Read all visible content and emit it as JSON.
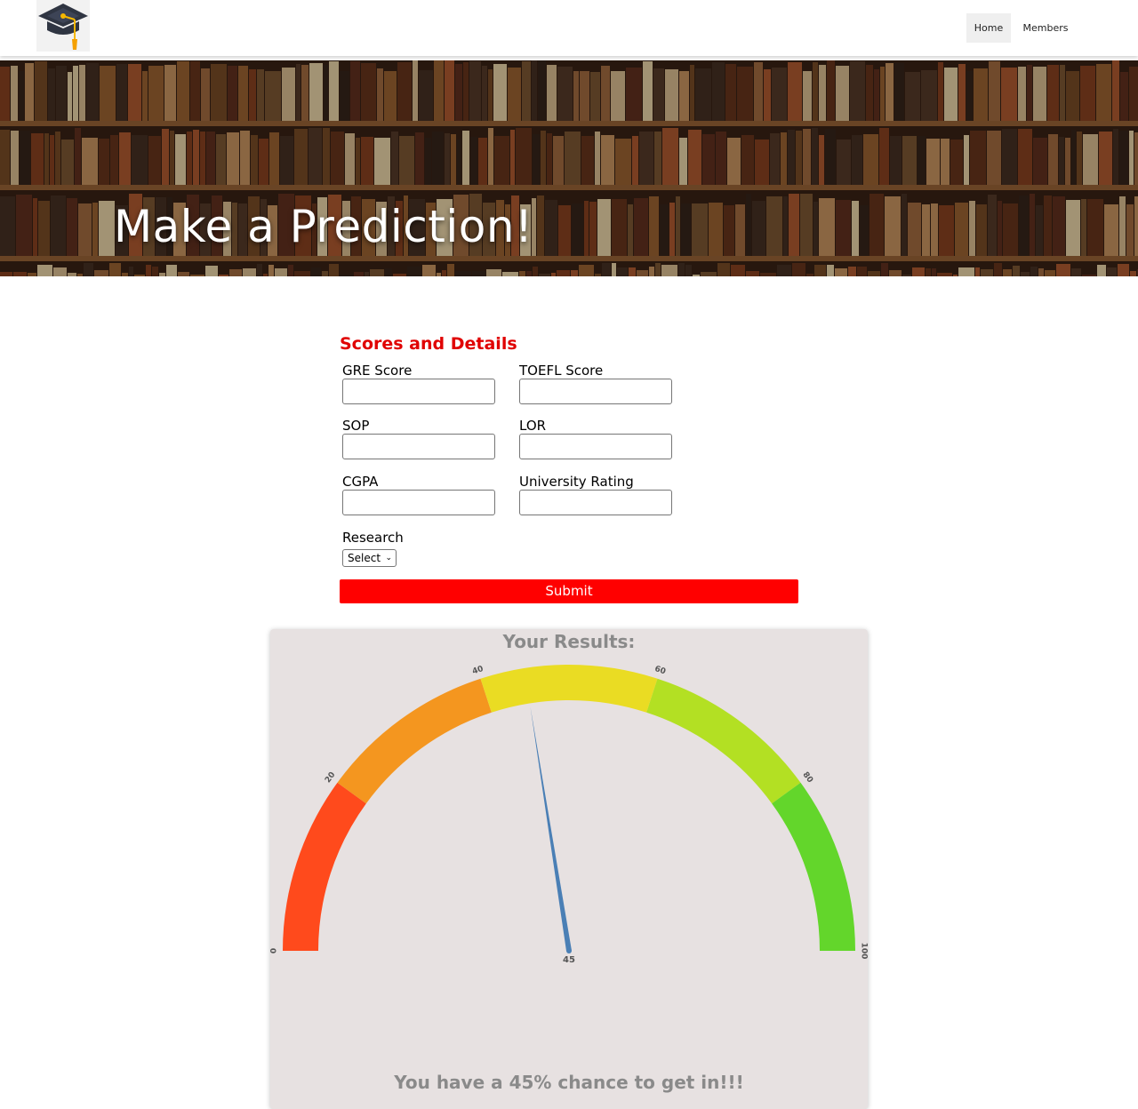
{
  "nav": {
    "logo_icon": "graduation-cap-icon",
    "items": [
      {
        "label": "Home",
        "active": true
      },
      {
        "label": "Members",
        "active": false
      }
    ]
  },
  "hero": {
    "title": "Make a Prediction!"
  },
  "form": {
    "heading": "Scores and Details",
    "fields": [
      {
        "label": "GRE Score",
        "value": "",
        "placeholder": ""
      },
      {
        "label": "TOEFL Score",
        "value": "",
        "placeholder": ""
      },
      {
        "label": "SOP",
        "value": "",
        "placeholder": ""
      },
      {
        "label": "LOR",
        "value": "",
        "placeholder": ""
      },
      {
        "label": "CGPA",
        "value": "",
        "placeholder": ""
      },
      {
        "label": "University Rating",
        "value": "",
        "placeholder": ""
      }
    ],
    "research": {
      "label": "Research",
      "selected": "Select"
    },
    "submit_label": "Submit"
  },
  "results": {
    "title": "Your Results:",
    "message": "You have a 45% chance to get in!!!",
    "gauge": {
      "min": 0,
      "max": 100,
      "value": 45,
      "value_label": "45",
      "tick_labels": [
        "0",
        "20",
        "40",
        "60",
        "80",
        "100"
      ],
      "bands": [
        {
          "from": 0,
          "to": 20,
          "color": "#ff4a1c"
        },
        {
          "from": 20,
          "to": 40,
          "color": "#f4961f"
        },
        {
          "from": 40,
          "to": 60,
          "color": "#eadc23"
        },
        {
          "from": 60,
          "to": 80,
          "color": "#b3e023"
        },
        {
          "from": 80,
          "to": 100,
          "color": "#63d62b"
        }
      ],
      "needle_color": "#4a7fb5"
    }
  },
  "colors": {
    "accent": "#ff0000",
    "heading": "#e00000",
    "card_bg": "#e7e1e1",
    "muted_text": "#8a8a8a"
  }
}
